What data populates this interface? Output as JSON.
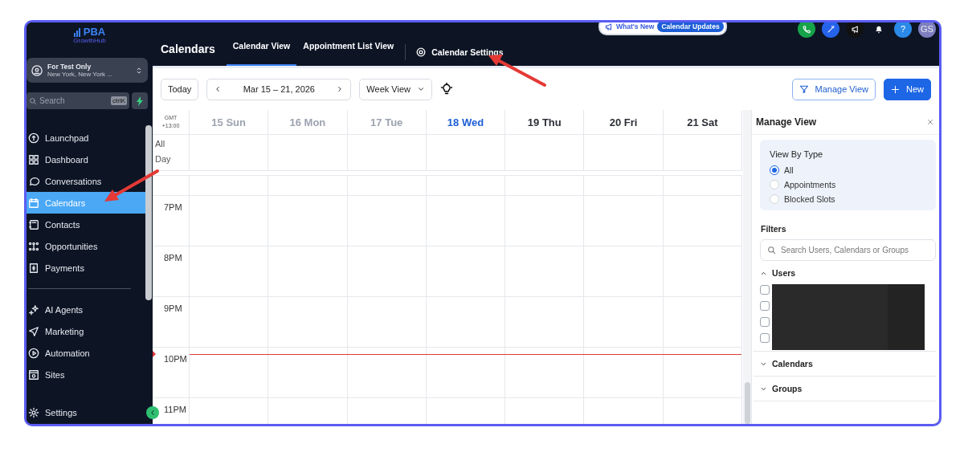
{
  "sidebar": {
    "logo": {
      "title": "PBA",
      "subtitle": "GrowthHub"
    },
    "account": {
      "name": "For Test Only",
      "location": "New York, New York ..."
    },
    "search": {
      "placeholder": "Search",
      "shortcut": "ctrlK"
    },
    "nav": [
      {
        "label": "Launchpad",
        "selected": false
      },
      {
        "label": "Dashboard",
        "selected": false
      },
      {
        "label": "Conversations",
        "selected": false
      },
      {
        "label": "Calendars",
        "selected": true
      },
      {
        "label": "Contacts",
        "selected": false
      },
      {
        "label": "Opportunities",
        "selected": false
      },
      {
        "label": "Payments",
        "selected": false
      }
    ],
    "nav_more": [
      {
        "label": "AI Agents",
        "selected": false
      },
      {
        "label": "Marketing",
        "selected": false
      },
      {
        "label": "Automation",
        "selected": false
      },
      {
        "label": "Sites",
        "selected": false
      }
    ],
    "footer": {
      "label": "Settings"
    }
  },
  "topbar": {
    "title": "Calendars",
    "tabs": [
      {
        "label": "Calendar View",
        "selected": true
      },
      {
        "label": "Appointment List View",
        "selected": false
      }
    ],
    "settings_link": "Calendar Settings",
    "whats_new": "What's New",
    "updates_badge": "Calendar Updates",
    "help": "?",
    "avatar": "GS"
  },
  "toolbar": {
    "today": "Today",
    "range": "Mar 15 – 21, 2026",
    "view": "Week View",
    "manage": "Manage View",
    "new": "New"
  },
  "calendar": {
    "timezone_label": "GMT",
    "timezone_offset": "+13:00",
    "all_day": "All Day",
    "days": [
      {
        "label": "15 Sun",
        "kind": "past"
      },
      {
        "label": "16 Mon",
        "kind": "past"
      },
      {
        "label": "17 Tue",
        "kind": "past"
      },
      {
        "label": "18 Wed",
        "kind": "today"
      },
      {
        "label": "19 Thu",
        "kind": "future"
      },
      {
        "label": "20 Fri",
        "kind": "future"
      },
      {
        "label": "21 Sat",
        "kind": "future"
      }
    ],
    "hours": [
      "7PM",
      "8PM",
      "9PM",
      "10PM",
      "11PM"
    ]
  },
  "panel": {
    "title": "Manage View",
    "view_by": {
      "title": "View By Type",
      "options": [
        {
          "label": "All",
          "selected": true
        },
        {
          "label": "Appointments",
          "selected": false
        },
        {
          "label": "Blocked Slots",
          "selected": false
        }
      ]
    },
    "filters": {
      "title": "Filters",
      "placeholder": "Search Users, Calendars or Groups"
    },
    "sections": [
      {
        "label": "Users",
        "expanded": true,
        "users": [
          {
            "checked": false
          },
          {
            "checked": false
          },
          {
            "checked": false
          },
          {
            "checked": false
          }
        ]
      },
      {
        "label": "Calendars",
        "expanded": false
      },
      {
        "label": "Groups",
        "expanded": false
      }
    ]
  }
}
